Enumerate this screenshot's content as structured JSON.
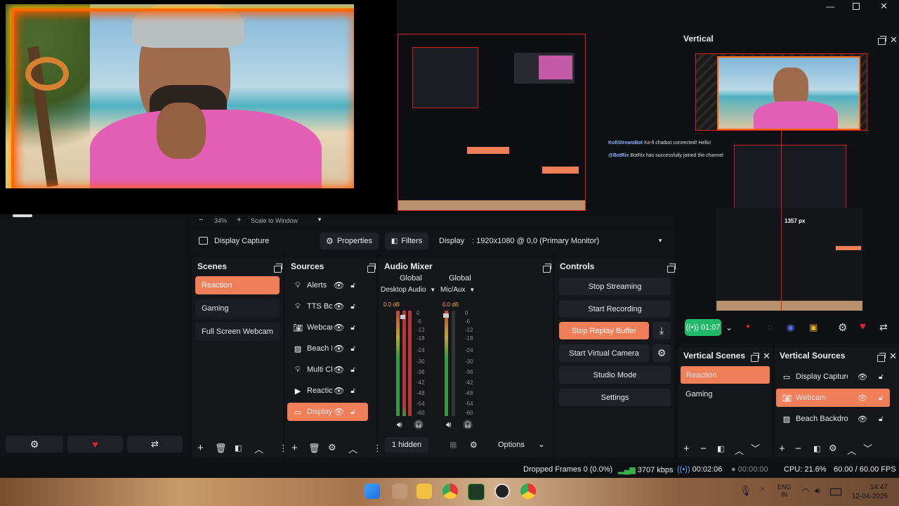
{
  "window": {
    "title": ""
  },
  "preview": {
    "zoom": "34%",
    "scale_mode": "Scale to Window",
    "minus": "−",
    "plus": "+"
  },
  "vertical_preview": {
    "title": "Vertical",
    "chat_line1_user": "KofiStreamBot",
    "chat_line1_text": "Ko-fi chatbot connected! Hello!",
    "chat_line2_user": "@BotRix",
    "chat_line2_text": "BotRix has successfully joined the channel",
    "px_label": "1357 px",
    "timer": "01:07"
  },
  "source_toolbar": {
    "source_name": "Display Capture",
    "properties": "Properties",
    "filters": "Filters",
    "display_label": "Display",
    "display_value": ": 1920x1080 @ 0,0 (Primary Monitor)"
  },
  "scenes": {
    "title": "Scenes",
    "items": [
      "Reaction",
      "Gaming",
      "Full Screen Webcam"
    ],
    "active": 0
  },
  "sources": {
    "title": "Sources",
    "items": [
      {
        "name": "Alerts",
        "icon": "bulb-icon"
      },
      {
        "name": "TTS Bot",
        "icon": "bulb-icon"
      },
      {
        "name": "Webcam",
        "icon": "camera-icon"
      },
      {
        "name": "Beach Backdrop",
        "icon": "image-icon"
      },
      {
        "name": "Multi Chat",
        "icon": "bulb-icon"
      },
      {
        "name": "Reaction",
        "icon": "play-icon"
      },
      {
        "name": "Display Capture",
        "icon": "monitor-icon"
      }
    ],
    "active": 6
  },
  "audio_mixer": {
    "title": "Audio Mixer",
    "ch1": {
      "scope": "Global",
      "name": "Desktop Audio",
      "db": "0.0 dB"
    },
    "ch2": {
      "scope": "Global",
      "name": "Mic/Aux",
      "db": "0.0 dB"
    },
    "ticks": [
      "0",
      "-6",
      "-12",
      "-18",
      "-24",
      "-30",
      "-36",
      "-42",
      "-48",
      "-54",
      "-60"
    ],
    "hidden": "1 hidden",
    "options": "Options"
  },
  "controls": {
    "title": "Controls",
    "stop_streaming": "Stop Streaming",
    "start_recording": "Start Recording",
    "stop_replay": "Stop Replay Buffer",
    "start_virtual_camera": "Start Virtual Camera",
    "studio_mode": "Studio Mode",
    "settings": "Settings"
  },
  "vertical_scenes": {
    "title": "Vertical Scenes",
    "items": [
      "Reaction",
      "Gaming"
    ],
    "active": 0
  },
  "vertical_sources": {
    "title": "Vertical Sources",
    "items": [
      {
        "name": "Display Capture",
        "icon": "monitor-icon"
      },
      {
        "name": "Webcam",
        "icon": "camera-icon"
      },
      {
        "name": "Beach Backdrop",
        "icon": "image-icon"
      }
    ],
    "active": 1
  },
  "status_bar": {
    "dropped_frames": "Dropped Frames 0 (0.0%)",
    "bitrate": "3707 kbps",
    "stream_time": "00:02:06",
    "rec_time": "00:00:00",
    "cpu": "CPU: 21.6%",
    "fps": "60.00 / 60.00 FPS"
  },
  "taskbar": {
    "lang": "ENG",
    "region": "IN",
    "time": "14:47",
    "date": "12-04-2026"
  },
  "colors": {
    "accent": "#f07e58",
    "panel": "#16171b",
    "background": "#101114"
  }
}
